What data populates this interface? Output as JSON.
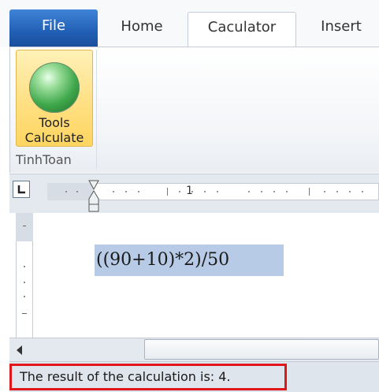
{
  "tabs": [
    {
      "label": "File"
    },
    {
      "label": "Home"
    },
    {
      "label": "Caculator"
    },
    {
      "label": "Insert"
    }
  ],
  "ribbon": {
    "button": {
      "line1": "Tools",
      "line2": "Calculate",
      "icon": "green-orb-icon"
    },
    "group_label": "TinhToan"
  },
  "ruler": {
    "number": "1"
  },
  "document": {
    "formula": "((90+10)*2)/50"
  },
  "status": {
    "text": "The result of the calculation is: 4."
  },
  "colors": {
    "file_tab": "#215fb4",
    "selection": "#b7cbe6",
    "highlight_border": "#e0161a",
    "button_glow": "#ffe188"
  }
}
